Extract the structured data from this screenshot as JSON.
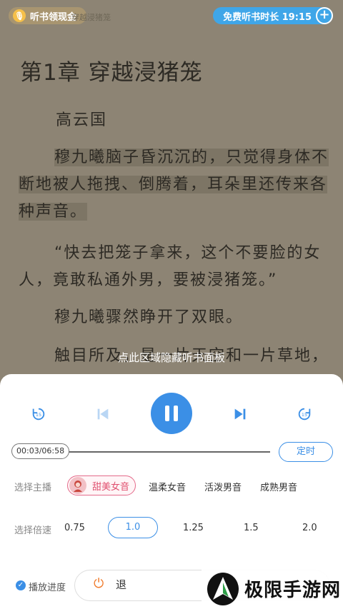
{
  "reader": {
    "top_left_pill": "听书领现金",
    "ghost_text": "穿越浸猪笼",
    "top_right_pill": "免费听书时长 19:15",
    "plus": "+",
    "chapter_title": "第1章  穿越浸猪笼",
    "paragraphs": [
      "高云国",
      "穆九曦脑子昏沉沉的，只觉得身体不断地被人拖拽、倒腾着，耳朵里还传来各种声音。",
      "“快去把笼子拿来，这个不要脸的女人，竟敢私通外男，要被浸猪笼。”",
      "穆九曦骤然睁开了双眼。",
      "触目所及，是一片天空和一片草地，"
    ],
    "hide_hint": "点此区域隐藏听书面板"
  },
  "panel": {
    "controls": {
      "rewind_icon": "rewind-15-icon",
      "prev_icon": "previous-chapter-icon",
      "play_icon": "pause-icon",
      "next_icon": "next-chapter-icon",
      "forward_icon": "forward-15-icon",
      "skip_seconds": "15"
    },
    "progress": {
      "time": "00:03/06:58",
      "fraction": 0.007,
      "timer_label": "定时"
    },
    "voice": {
      "label": "选择主播",
      "selected": "甜美女音",
      "options": [
        "温柔女音",
        "活泼男音",
        "成熟男音"
      ]
    },
    "speed": {
      "label": "选择倍速",
      "options": [
        "0.75",
        "1.0",
        "1.25",
        "1.5",
        "2.0"
      ],
      "selected": "1.0"
    },
    "bottom": {
      "progress_label": "播放进度",
      "exit_label": "退"
    }
  },
  "watermark": {
    "text": "极限手游网"
  },
  "colors": {
    "accent": "#3b8fe6",
    "voice_accent": "#e0506f",
    "page_bg": "#8d8474"
  }
}
